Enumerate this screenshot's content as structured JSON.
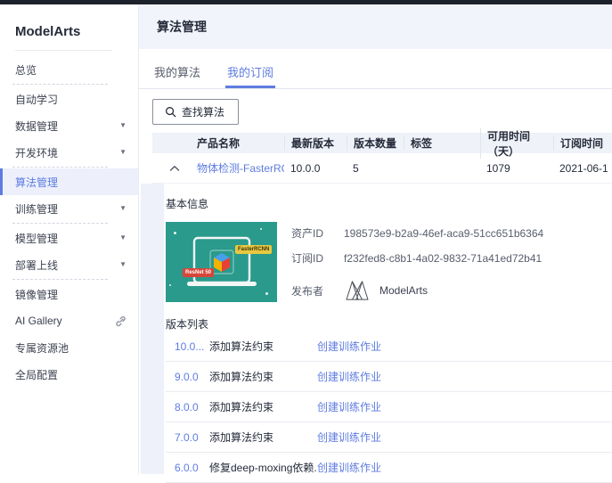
{
  "sidebar": {
    "brand": "ModelArts",
    "items": [
      {
        "label": "总览",
        "arrow": false,
        "active": false
      },
      {
        "label": "自动学习",
        "arrow": false,
        "active": false
      },
      {
        "label": "数据管理",
        "arrow": true,
        "active": false
      },
      {
        "label": "开发环境",
        "arrow": true,
        "active": false
      },
      {
        "label": "算法管理",
        "arrow": false,
        "active": true
      },
      {
        "label": "训练管理",
        "arrow": true,
        "active": false
      },
      {
        "label": "模型管理",
        "arrow": true,
        "active": false
      },
      {
        "label": "部署上线",
        "arrow": true,
        "active": false
      },
      {
        "label": "镜像管理",
        "arrow": false,
        "active": false
      },
      {
        "label": "AI Gallery",
        "arrow": false,
        "active": false,
        "external": true
      },
      {
        "label": "专属资源池",
        "arrow": false,
        "active": false
      },
      {
        "label": "全局配置",
        "arrow": false,
        "active": false
      }
    ]
  },
  "header": {
    "title": "算法管理"
  },
  "tabs": [
    {
      "label": "我的算法",
      "active": false
    },
    {
      "label": "我的订阅",
      "active": true
    }
  ],
  "toolbar": {
    "search_button": "查找算法"
  },
  "table": {
    "columns": [
      "产品名称",
      "最新版本",
      "版本数量",
      "标签",
      "可用时间（天）",
      "订阅时间"
    ],
    "row": {
      "name": "物体检测-FasterRCN...",
      "latest_version": "10.0.0",
      "version_count": "5",
      "tag": "",
      "available_days": "1079",
      "subscribe_time": "2021-06-1"
    }
  },
  "detail": {
    "basic_info_label": "基本信息",
    "thumbnail": {
      "tag_model": "FasterRCNN",
      "tag_backbone": "ResNet 50"
    },
    "asset_id_label": "资产ID",
    "asset_id": "198573e9-b2a9-46ef-aca9-51cc651b6364",
    "subscription_id_label": "订阅ID",
    "subscription_id": "f232fed8-c8b1-4a02-9832-71a41ed72b41",
    "publisher_label": "发布者",
    "publisher": "ModelArts",
    "version_list_label": "版本列表",
    "versions": [
      {
        "version": "10.0...",
        "desc": "添加算法约束",
        "action": "创建训练作业"
      },
      {
        "version": "9.0.0",
        "desc": "添加算法约束",
        "action": "创建训练作业"
      },
      {
        "version": "8.0.0",
        "desc": "添加算法约束",
        "action": "创建训练作业"
      },
      {
        "version": "7.0.0",
        "desc": "添加算法约束",
        "action": "创建训练作业"
      },
      {
        "version": "6.0.0",
        "desc": "修复deep-moxing依赖...",
        "action": "创建训练作业"
      }
    ]
  },
  "colors": {
    "accent": "#5e7ce0",
    "topbar": "#1d212b",
    "header_band": "#f2f4fb",
    "table_header_bg": "#f0f2f9",
    "expanded_stripe": "#eef0fa",
    "thumbnail_teal": "#2a9a8c",
    "badge_yellow": "#e9c840",
    "badge_red": "#d8453a"
  }
}
